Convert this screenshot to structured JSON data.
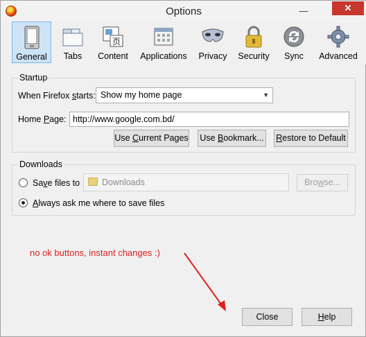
{
  "window": {
    "title": "Options"
  },
  "toolbar": {
    "items": [
      {
        "label": "General",
        "icon": "general-icon",
        "selected": true
      },
      {
        "label": "Tabs",
        "icon": "tabs-icon"
      },
      {
        "label": "Content",
        "icon": "content-icon"
      },
      {
        "label": "Applications",
        "icon": "applications-icon"
      },
      {
        "label": "Privacy",
        "icon": "privacy-mask-icon"
      },
      {
        "label": "Security",
        "icon": "lock-icon"
      },
      {
        "label": "Sync",
        "icon": "sync-icon"
      },
      {
        "label": "Advanced",
        "icon": "gear-icon"
      }
    ]
  },
  "startup": {
    "title": "Startup",
    "when_label_pre": "When Firefox ",
    "when_label_u": "s",
    "when_label_post": "tarts:",
    "when_value": "Show my home page",
    "home_label_pre": "Home ",
    "home_label_u": "P",
    "home_label_post": "age:",
    "home_value": "http://www.google.com.bd/",
    "btn_current_pre": "Use ",
    "btn_current_u": "C",
    "btn_current_post": "urrent Pages",
    "btn_bookmark_pre": "Use ",
    "btn_bookmark_u": "B",
    "btn_bookmark_post": "ookmark...",
    "btn_restore_u": "R",
    "btn_restore_post": "estore to Default"
  },
  "downloads": {
    "title": "Downloads",
    "save_pre": "Sa",
    "save_u": "v",
    "save_post": "e files to",
    "folder": "Downloads",
    "browse_pre": "Bro",
    "browse_u": "w",
    "browse_post": "se...",
    "always_u": "A",
    "always_post": "lways ask me where to save files",
    "selected": "always"
  },
  "annotation": {
    "text": "no ok buttons, instant changes :)",
    "color": "#e02020"
  },
  "footer": {
    "close_label": "Close",
    "help_u": "H",
    "help_post": "elp"
  }
}
